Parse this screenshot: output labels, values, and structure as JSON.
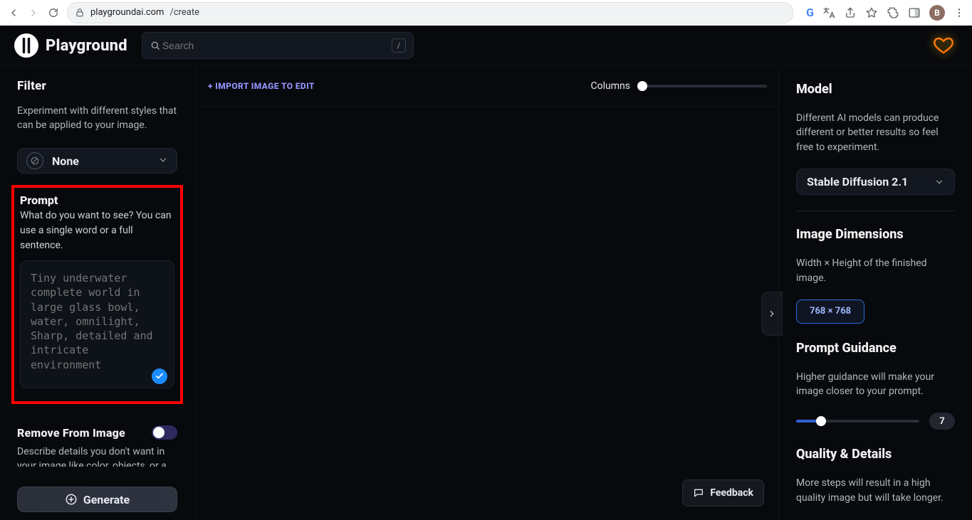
{
  "browser": {
    "url_host": "playgroundai.com",
    "url_path": "/create",
    "avatar_letter": "B"
  },
  "header": {
    "app_name": "Playground",
    "search_placeholder": "Search",
    "search_shortcut": "/"
  },
  "left": {
    "filter": {
      "title": "Filter",
      "subtitle": "Experiment with different styles that can be applied to your image.",
      "selected": "None"
    },
    "prompt": {
      "title": "Prompt",
      "subtitle": "What do you want to see? You can use a single word or a full sentence.",
      "placeholder": "Tiny underwater complete world in large glass bowl, water, omnilight, Sharp, detailed and intricate environment",
      "value": ""
    },
    "remove": {
      "title": "Remove From Image",
      "subtitle": "Describe details you don't want in your image like color, objects, or a",
      "enabled": false
    },
    "generate_label": "Generate"
  },
  "center": {
    "import_label": "+ IMPORT IMAGE TO EDIT",
    "columns_label": "Columns",
    "feedback_label": "Feedback"
  },
  "right": {
    "model": {
      "title": "Model",
      "subtitle": "Different AI models can produce different or better results so feel free to experiment.",
      "selected": "Stable Diffusion 2.1"
    },
    "dimensions": {
      "title": "Image Dimensions",
      "subtitle": "Width × Height of the finished image.",
      "selected": "768 × 768"
    },
    "guidance": {
      "title": "Prompt Guidance",
      "subtitle": "Higher guidance will make your image closer to your prompt.",
      "value": "7",
      "percent": 20
    },
    "quality": {
      "title": "Quality & Details",
      "subtitle": "More steps will result in a high quality image but will take longer."
    }
  }
}
